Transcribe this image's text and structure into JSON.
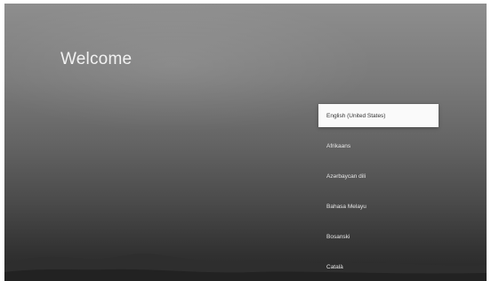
{
  "screen": {
    "title": "Welcome"
  },
  "languages": {
    "selected_index": 0,
    "items": [
      {
        "label": "English (United States)"
      },
      {
        "label": "Afrikaans"
      },
      {
        "label": "Azərbaycan dili"
      },
      {
        "label": "Bahasa Melayu"
      },
      {
        "label": "Bosanski"
      },
      {
        "label": "Català"
      }
    ]
  },
  "colors": {
    "selected_background": "#fafafa",
    "selected_text": "#333333",
    "item_text": "#e6e6e6",
    "title_text": "#f2f2f2"
  }
}
